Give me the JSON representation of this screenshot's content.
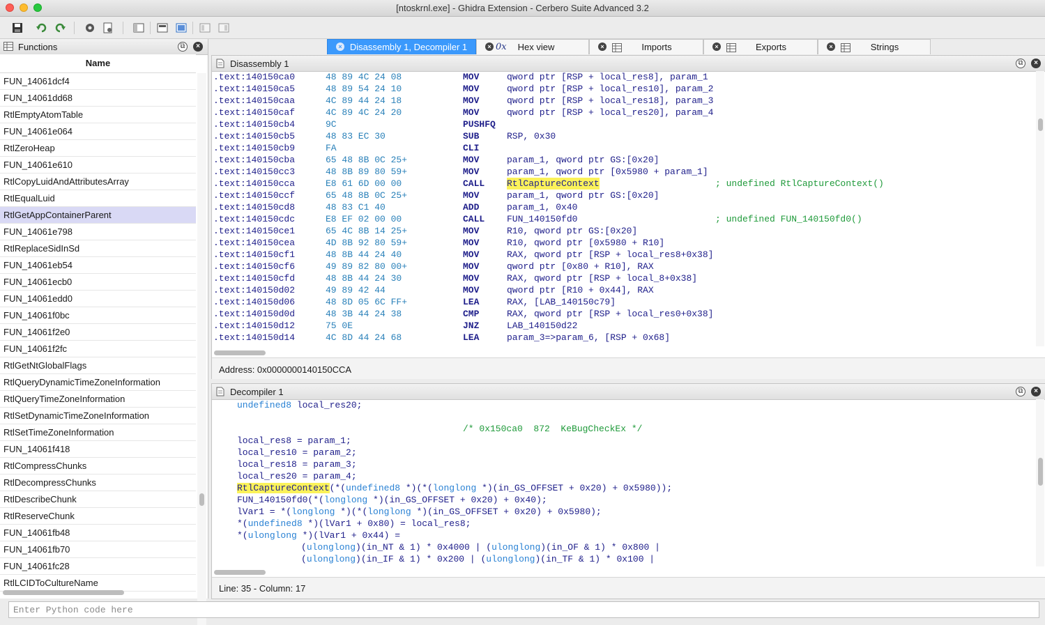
{
  "window": {
    "title": "[ntoskrnl.exe] - Ghidra Extension - Cerbero Suite Advanced 3.2"
  },
  "toolbar": {
    "icons": [
      "save-icon",
      "undo-icon",
      "redo-icon",
      "settings-icon",
      "script-icon",
      "window-icon",
      "split-icon",
      "sync-icon",
      "layout-left-icon",
      "layout-right-icon"
    ]
  },
  "functions": {
    "title": "Functions",
    "column": "Name",
    "selected": "RtlGetAppContainerParent",
    "items": [
      "FUN_14061dcf4",
      "FUN_14061dd68",
      "RtlEmptyAtomTable",
      "FUN_14061e064",
      "RtlZeroHeap",
      "FUN_14061e610",
      "RtlCopyLuidAndAttributesArray",
      "RtlEqualLuid",
      "RtlGetAppContainerParent",
      "FUN_14061e798",
      "RtlReplaceSidInSd",
      "FUN_14061eb54",
      "FUN_14061ecb0",
      "FUN_14061edd0",
      "FUN_14061f0bc",
      "FUN_14061f2e0",
      "FUN_14061f2fc",
      "RtlGetNtGlobalFlags",
      "RtlQueryDynamicTimeZoneInformation",
      "RtlQueryTimeZoneInformation",
      "RtlSetDynamicTimeZoneInformation",
      "RtlSetTimeZoneInformation",
      "FUN_14061f418",
      "RtlCompressChunks",
      "RtlDecompressChunks",
      "RtlDescribeChunk",
      "RtlReserveChunk",
      "FUN_14061fb48",
      "FUN_14061fb70",
      "FUN_14061fc28",
      "RtlLCIDToCultureName"
    ]
  },
  "tabs": [
    {
      "label": "Disassembly 1, Decompiler 1",
      "active": true
    },
    {
      "label": "Hex view",
      "prefix": "0x"
    },
    {
      "label": "Imports"
    },
    {
      "label": "Exports"
    },
    {
      "label": "Strings"
    }
  ],
  "disassembly": {
    "title": "Disassembly 1",
    "status": "Address: 0x0000000140150CCA",
    "lines": [
      {
        "addr": ".text:140150ca0",
        "bytes": "48 89 4C 24 08",
        "mn": "MOV",
        "op": "qword ptr [RSP + local_res8], param_1",
        "cm": ""
      },
      {
        "addr": ".text:140150ca5",
        "bytes": "48 89 54 24 10",
        "mn": "MOV",
        "op": "qword ptr [RSP + local_res10], param_2",
        "cm": ""
      },
      {
        "addr": ".text:140150caa",
        "bytes": "4C 89 44 24 18",
        "mn": "MOV",
        "op": "qword ptr [RSP + local_res18], param_3",
        "cm": ""
      },
      {
        "addr": ".text:140150caf",
        "bytes": "4C 89 4C 24 20",
        "mn": "MOV",
        "op": "qword ptr [RSP + local_res20], param_4",
        "cm": ""
      },
      {
        "addr": ".text:140150cb4",
        "bytes": "9C",
        "mn": "PUSHFQ",
        "op": "",
        "cm": ""
      },
      {
        "addr": ".text:140150cb5",
        "bytes": "48 83 EC 30",
        "mn": "SUB",
        "op": "RSP, 0x30",
        "cm": ""
      },
      {
        "addr": ".text:140150cb9",
        "bytes": "FA",
        "mn": "CLI",
        "op": "",
        "cm": ""
      },
      {
        "addr": ".text:140150cba",
        "bytes": "65 48 8B 0C 25+",
        "mn": "MOV",
        "op": "param_1, qword ptr GS:[0x20]",
        "cm": ""
      },
      {
        "addr": ".text:140150cc3",
        "bytes": "48 8B 89 80 59+",
        "mn": "MOV",
        "op": "param_1, qword ptr [0x5980 + param_1]",
        "cm": ""
      },
      {
        "addr": ".text:140150cca",
        "bytes": "E8 61 6D 00 00",
        "mn": "CALL",
        "op": "RtlCaptureContext",
        "cm": "; undefined RtlCaptureContext()",
        "hl": true
      },
      {
        "addr": ".text:140150ccf",
        "bytes": "65 48 8B 0C 25+",
        "mn": "MOV",
        "op": "param_1, qword ptr GS:[0x20]",
        "cm": ""
      },
      {
        "addr": ".text:140150cd8",
        "bytes": "48 83 C1 40",
        "mn": "ADD",
        "op": "param_1, 0x40",
        "cm": ""
      },
      {
        "addr": ".text:140150cdc",
        "bytes": "E8 EF 02 00 00",
        "mn": "CALL",
        "op": "FUN_140150fd0",
        "cm": "; undefined FUN_140150fd0()"
      },
      {
        "addr": ".text:140150ce1",
        "bytes": "65 4C 8B 14 25+",
        "mn": "MOV",
        "op": "R10, qword ptr GS:[0x20]",
        "cm": ""
      },
      {
        "addr": ".text:140150cea",
        "bytes": "4D 8B 92 80 59+",
        "mn": "MOV",
        "op": "R10, qword ptr [0x5980 + R10]",
        "cm": ""
      },
      {
        "addr": ".text:140150cf1",
        "bytes": "48 8B 44 24 40",
        "mn": "MOV",
        "op": "RAX, qword ptr [RSP + local_res8+0x38]",
        "cm": ""
      },
      {
        "addr": ".text:140150cf6",
        "bytes": "49 89 82 80 00+",
        "mn": "MOV",
        "op": "qword ptr [0x80 + R10], RAX",
        "cm": ""
      },
      {
        "addr": ".text:140150cfd",
        "bytes": "48 8B 44 24 30",
        "mn": "MOV",
        "op": "RAX, qword ptr [RSP + local_8+0x38]",
        "cm": ""
      },
      {
        "addr": ".text:140150d02",
        "bytes": "49 89 42 44",
        "mn": "MOV",
        "op": "qword ptr [R10 + 0x44], RAX",
        "cm": ""
      },
      {
        "addr": ".text:140150d06",
        "bytes": "48 8D 05 6C FF+",
        "mn": "LEA",
        "op": "RAX, [LAB_140150c79]",
        "cm": ""
      },
      {
        "addr": ".text:140150d0d",
        "bytes": "48 3B 44 24 38",
        "mn": "CMP",
        "op": "RAX, qword ptr [RSP + local_res0+0x38]",
        "cm": ""
      },
      {
        "addr": ".text:140150d12",
        "bytes": "75 0E",
        "mn": "JNZ",
        "op": "LAB_140150d22",
        "cm": ""
      },
      {
        "addr": ".text:140150d14",
        "bytes": "4C 8D 44 24 68",
        "mn": "LEA",
        "op": "param_3=>param_6, [RSP + 0x68]",
        "cm": ""
      }
    ]
  },
  "decompiler": {
    "title": "Decompiler 1",
    "status": "Line: 35 - Column: 17",
    "lines": [
      "undefined8 local_res20;",
      "",
      "/* 0x150ca0  872  KeBugCheckEx */",
      "local_res8 = param_1;",
      "local_res10 = param_2;",
      "local_res18 = param_3;",
      "local_res20 = param_4;",
      "RtlCaptureContext(*(undefined8 *)(*(longlong *)(in_GS_OFFSET + 0x20) + 0x5980));",
      "FUN_140150fd0(*(longlong *)(in_GS_OFFSET + 0x20) + 0x40);",
      "lVar1 = *(longlong *)(*(longlong *)(in_GS_OFFSET + 0x20) + 0x5980);",
      "*(undefined8 *)(lVar1 + 0x80) = local_res8;",
      "*(ulonglong *)(lVar1 + 0x44) =",
      "(ulonglong)(in_NT & 1) * 0x4000 | (ulonglong)(in_OF & 1) * 0x800 |",
      "(ulonglong)(in_IF & 1) * 0x200 | (ulonglong)(in_TF & 1) * 0x100 |"
    ]
  },
  "console": {
    "placeholder": "Enter Python code here"
  },
  "colors": {
    "accent": "#3b99fc",
    "highlight": "#fbf25a",
    "selection": "#d9d9f5"
  }
}
